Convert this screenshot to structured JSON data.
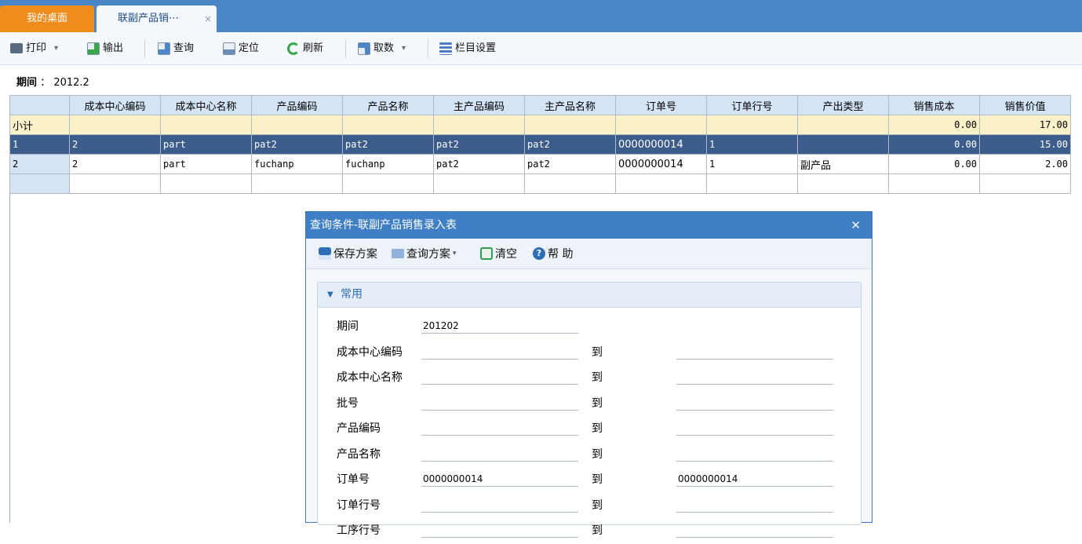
{
  "tabs": {
    "home": "我的桌面",
    "active": "联副产品销⋯",
    "close_glyph": "×"
  },
  "toolbar": {
    "print": "打印",
    "export": "输出",
    "query": "查询",
    "locate": "定位",
    "refresh": "刷新",
    "fetch": "取数",
    "columns": "栏目设置",
    "dropdown_glyph": "▾"
  },
  "period": {
    "label": "期间",
    "sep": "：",
    "value": "2012.2"
  },
  "grid": {
    "columns": [
      "成本中心编码",
      "成本中心名称",
      "产品编码",
      "产品名称",
      "主产品编码",
      "主产品名称",
      "订单号",
      "订单行号",
      "产出类型",
      "销售成本",
      "销售价值"
    ],
    "subtotal": {
      "label": "小计",
      "cost": "0.00",
      "value": "17.00"
    },
    "rows": [
      {
        "no": "1",
        "cc_code": "2",
        "cc_name": "part",
        "prod_code": "pat2",
        "prod_name": "pat2",
        "main_code": "pat2",
        "main_name": "pat2",
        "order_no": "0000000014",
        "order_line": "1",
        "out_type": "",
        "cost": "0.00",
        "value": "15.00"
      },
      {
        "no": "2",
        "cc_code": "2",
        "cc_name": "part",
        "prod_code": "fuchanp",
        "prod_name": "fuchanp",
        "main_code": "pat2",
        "main_name": "pat2",
        "order_no": "0000000014",
        "order_line": "1",
        "out_type": "副产品",
        "cost": "0.00",
        "value": "2.00"
      }
    ]
  },
  "dialog": {
    "title": "查询条件-联副产品销售录入表",
    "close_glyph": "✕",
    "save_scheme": "保存方案",
    "query_scheme": "查询方案",
    "clear": "清空",
    "help": "帮 助",
    "section": "常用",
    "to_label": "到",
    "fields": [
      {
        "label": "期间",
        "from": "201202",
        "to": null
      },
      {
        "label": "成本中心编码",
        "from": "",
        "to": ""
      },
      {
        "label": "成本中心名称",
        "from": "",
        "to": ""
      },
      {
        "label": "批号",
        "from": "",
        "to": ""
      },
      {
        "label": "产品编码",
        "from": "",
        "to": ""
      },
      {
        "label": "产品名称",
        "from": "",
        "to": ""
      },
      {
        "label": "订单号",
        "from": "0000000014",
        "to": "0000000014"
      },
      {
        "label": "订单行号",
        "from": "",
        "to": ""
      },
      {
        "label": "工序行号",
        "from": "",
        "to": ""
      }
    ]
  },
  "colors": {
    "tabbar": "#4a86c6",
    "home_tab": "#f08c1c",
    "selected_row": "#3c5d8c",
    "subtotal_row": "#faf1c8",
    "dialog_title": "#3f7fc5"
  }
}
